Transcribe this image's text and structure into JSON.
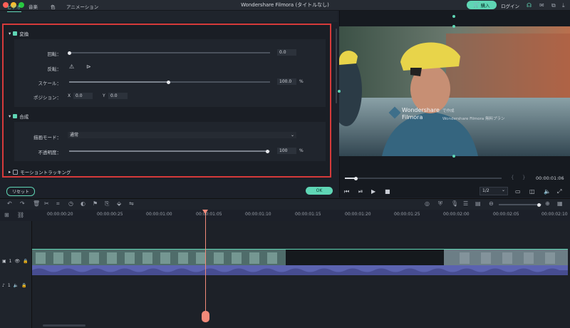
{
  "window": {
    "title": "Wondershare Filmora (タイトルなし)",
    "buy_label": "購入",
    "login_label": "ログイン"
  },
  "tabs": [
    {
      "label": "ビデオ"
    },
    {
      "label": "音楽"
    },
    {
      "label": "色"
    },
    {
      "label": "アニメーション"
    }
  ],
  "transform": {
    "header": "変換",
    "rotate_label": "回転：",
    "rotate_value": "0.0",
    "flip_label": "反転：",
    "scale_label": "スケール：",
    "scale_value": "100.0",
    "scale_unit": "%",
    "scale_level": 0.5,
    "position_label": "ポジション：",
    "x_label": "X",
    "x_value": "0.0",
    "y_label": "Y",
    "y_value": "0.0"
  },
  "composite": {
    "header": "合成",
    "blend_label": "描画モード：",
    "blend_value": "通常",
    "opacity_label": "不透明度：",
    "opacity_value": "100",
    "opacity_unit": "%",
    "opacity_level": 1.0
  },
  "motion_tracking": {
    "header": "モーショントラッキング"
  },
  "buttons": {
    "reset": "リセット",
    "ok": "OK"
  },
  "preview": {
    "overlay_brand": "Wondershare",
    "overlay_brand2": "Filmora",
    "overlay_note": "で作成",
    "overlay_sub": "Wondershare Filmora 無料プラン",
    "timecode": "00:00:01:06",
    "zoom": "1/2",
    "progress": 0.07
  },
  "ruler": {
    "labels": [
      "00:00:00:20",
      "00:00:01:00",
      "00:00:01:05",
      "00:00:01:10",
      "00:00:01:15",
      "00:00:01:20",
      "00:00:02:00",
      "00:00:02:05",
      "00:00:02:10"
    ]
  },
  "track_labels": {
    "video": "1",
    "audio": "1"
  },
  "colors": {
    "accent": "#5fd6b5",
    "highlight_border": "#d63a3a",
    "playhead": "#f28a7a",
    "audio": "#5b63b0"
  }
}
